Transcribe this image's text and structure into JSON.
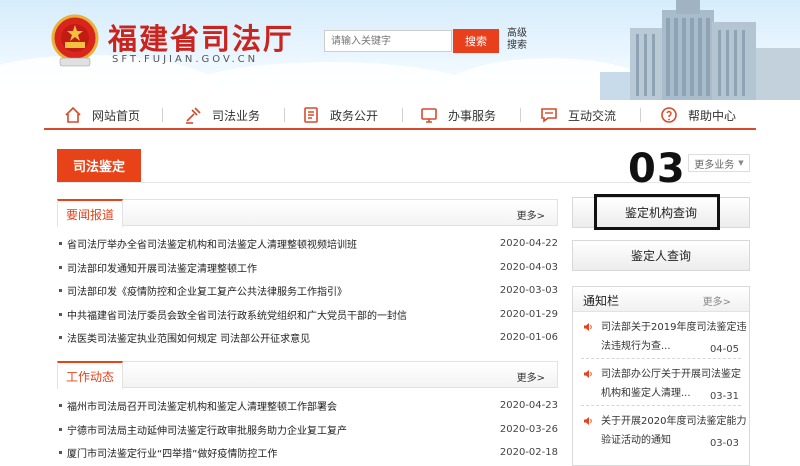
{
  "header": {
    "site_title": "福建省司法厅",
    "site_domain": "SFT.FUJIAN.GOV.CN",
    "search_placeholder": "请输入关键字",
    "search_button": "搜索",
    "advanced_search": "高级搜索"
  },
  "nav": [
    {
      "label": "网站首页",
      "icon": "home-icon"
    },
    {
      "label": "司法业务",
      "icon": "gavel-icon"
    },
    {
      "label": "政务公开",
      "icon": "document-icon"
    },
    {
      "label": "办事服务",
      "icon": "monitor-icon"
    },
    {
      "label": "互动交流",
      "icon": "chat-icon"
    },
    {
      "label": "帮助中心",
      "icon": "help-icon"
    }
  ],
  "section": {
    "title": "司法鉴定",
    "more_business": "更多业务",
    "annotation_number": "03"
  },
  "news_important": {
    "tab": "要闻报道",
    "more": "更多>",
    "items": [
      {
        "title": "省司法厅举办全省司法鉴定机构和司法鉴定人清理整顿视频培训班",
        "date": "2020-04-22"
      },
      {
        "title": "司法部印发通知开展司法鉴定清理整顿工作",
        "date": "2020-04-03"
      },
      {
        "title": "司法部印发《疫情防控和企业复工复产公共法律服务工作指引》",
        "date": "2020-03-03"
      },
      {
        "title": "中共福建省司法厅委员会致全省司法行政系统党组织和广大党员干部的一封信",
        "date": "2020-01-29"
      },
      {
        "title": "法医类司法鉴定执业范围如何规定 司法部公开征求意见",
        "date": "2020-01-06"
      }
    ]
  },
  "news_work": {
    "tab": "工作动态",
    "more": "更多>",
    "items": [
      {
        "title": "福州市司法局召开司法鉴定机构和鉴定人清理整顿工作部署会",
        "date": "2020-04-23"
      },
      {
        "title": "宁德市司法局主动延伸司法鉴定行政审批服务助力企业复工复产",
        "date": "2020-03-26"
      },
      {
        "title": "厦门市司法鉴定行业“四举措”做好疫情防控工作",
        "date": "2020-02-18"
      }
    ]
  },
  "right": {
    "institution_query": "鉴定机构查询",
    "appraiser_query": "鉴定人查询",
    "notice_title": "通知栏",
    "notice_more": "更多>",
    "notices": [
      {
        "line1": "司法部关于2019年度司法鉴定违",
        "line2": "法违规行为查...",
        "date": "04-05"
      },
      {
        "line1": "司法部办公厅关于开展司法鉴定",
        "line2": "机构和鉴定人清理...",
        "date": "03-31"
      },
      {
        "line1": "关于开展2020年度司法鉴定能力",
        "line2": "验证活动的通知",
        "date": "03-03"
      }
    ]
  },
  "colors": {
    "brand_red": "#c9251e",
    "accent_orange": "#e74218"
  }
}
